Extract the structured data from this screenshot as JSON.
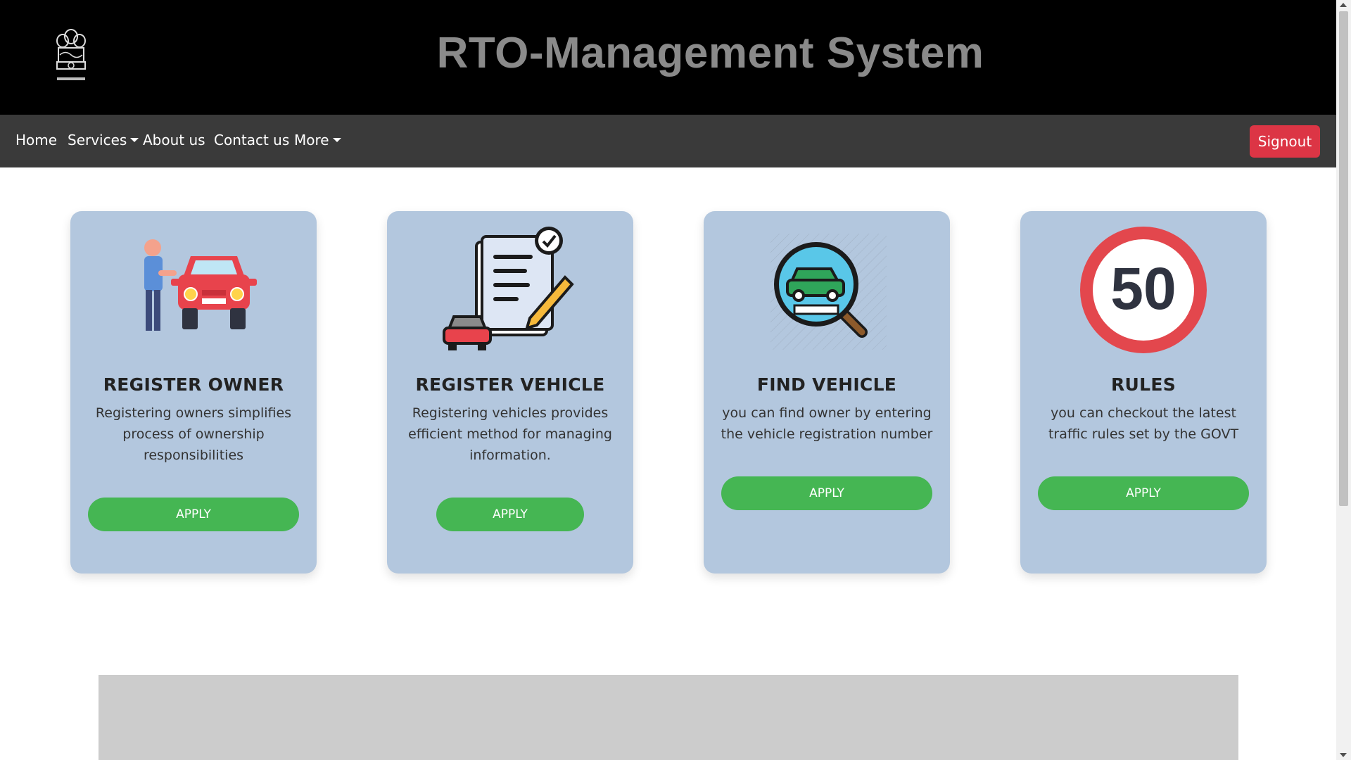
{
  "header": {
    "title": "RTO-Management System",
    "emblem_icon": "national-emblem-icon"
  },
  "nav": {
    "home": "Home",
    "services": "Services",
    "about": "About us",
    "contact": "Contact us",
    "more": "More",
    "signout": "Signout"
  },
  "cards": [
    {
      "title": "REGISTER OWNER",
      "description": "Registering owners simplifies process of ownership responsibilities",
      "button": "APPLY",
      "icon": "owner-with-car-icon"
    },
    {
      "title": "REGISTER VEHICLE",
      "description": "Registering vehicles provides efficient method for managing information.",
      "button": "APPLY",
      "icon": "document-car-pen-icon"
    },
    {
      "title": "FIND VEHICLE",
      "description": "you can find owner by entering the vehicle registration number",
      "button": "APPLY",
      "icon": "magnifier-car-icon"
    },
    {
      "title": "RULES",
      "description": "you can checkout the latest traffic rules set by the GOVT",
      "button": "APPLY",
      "icon": "speed-limit-sign-icon",
      "sign_text": "50"
    }
  ],
  "colors": {
    "header_bg": "#000000",
    "title_color": "#8a8a8a",
    "navbar_bg": "#3a3a3a",
    "signout_bg": "#dc3545",
    "card_bg": "#b3c7de",
    "apply_bg": "#45b653"
  }
}
